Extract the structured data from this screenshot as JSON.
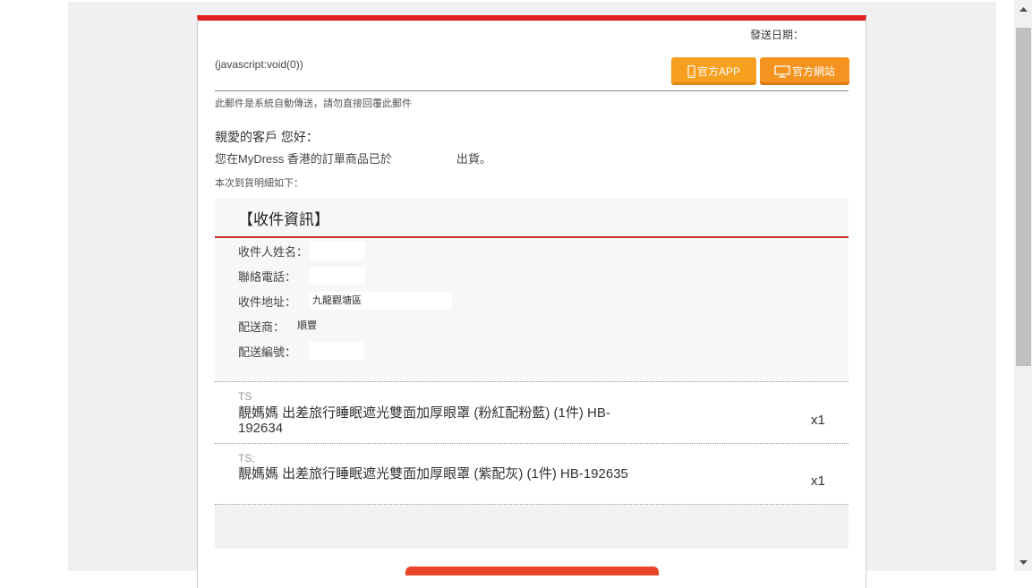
{
  "header": {
    "send_date_label": "發送日期：",
    "js_link": "(javascript:void(0))",
    "app_button": "官方APP",
    "web_button": "官方網站"
  },
  "intro": {
    "auto_note": "此郵件是系統自動傳送，請勿直接回覆此郵件",
    "greeting": "親愛的客戶 您好：",
    "shipped_prefix": "您在MyDress 香港的訂單商品已於",
    "shipped_suffix": "出貨。",
    "detail_note": "本次到貨明細如下："
  },
  "recipient_info": {
    "title": "【收件資訊】",
    "rows": [
      {
        "label": "收件人姓名：",
        "value": ""
      },
      {
        "label": "聯絡電話：",
        "value": ""
      },
      {
        "label": "收件地址：",
        "value": "九龍觀塘區"
      },
      {
        "label": "配送商：",
        "value": "順豐"
      },
      {
        "label": "配送編號：",
        "value": ""
      }
    ]
  },
  "items": [
    {
      "sku": "TS",
      "name": "靚媽媽 出差旅行睡眠遮光雙面加厚眼罩 (粉紅配粉藍) (1件) HB-192634",
      "qty": "x1"
    },
    {
      "sku": "TS;",
      "name": "靚媽媽 出差旅行睡眠遮光雙面加厚眼罩 (紫配灰) (1件) HB-192635",
      "qty": "x1"
    }
  ],
  "colors": {
    "accent_red": "#e0201f",
    "button_orange": "#f7a020"
  },
  "icons": {
    "app": "mobile-phone-icon",
    "web": "monitor-icon",
    "scroll_up": "arrow-up-icon",
    "scroll_down": "arrow-down-icon"
  }
}
